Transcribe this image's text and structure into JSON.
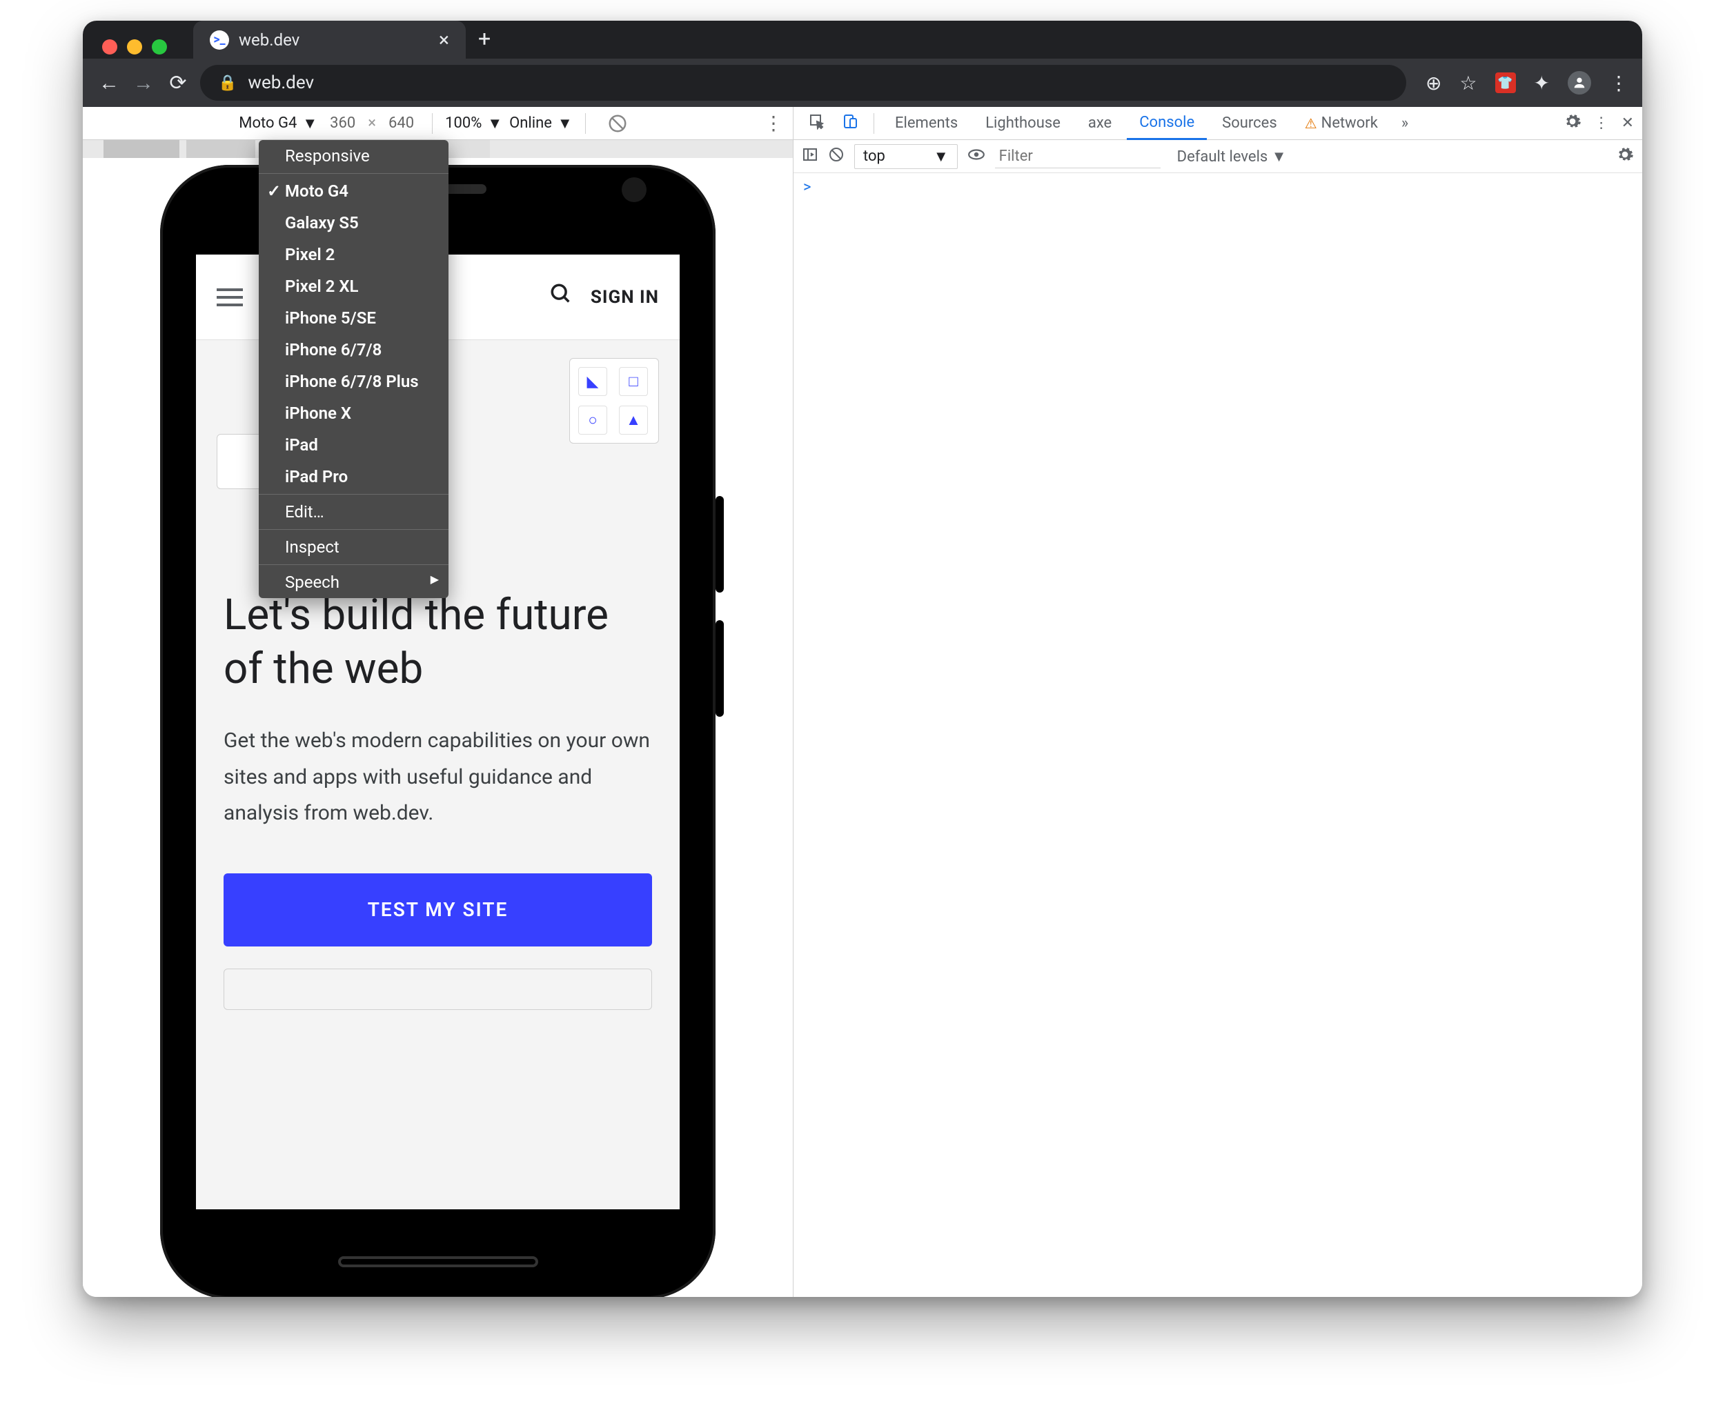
{
  "browser": {
    "tab_title": "web.dev",
    "url": "web.dev",
    "actions": {
      "add": "⊕",
      "star": "☆",
      "puzzle": "✦",
      "menu": "⋮"
    }
  },
  "deviceBar": {
    "device": "Moto G4",
    "width": "360",
    "height": "640",
    "zoom": "100%",
    "throttle": "Online"
  },
  "deviceMenu": {
    "responsive": "Responsive",
    "devices": [
      "Moto G4",
      "Galaxy S5",
      "Pixel 2",
      "Pixel 2 XL",
      "iPhone 5/SE",
      "iPhone 6/7/8",
      "iPhone 6/7/8 Plus",
      "iPhone X",
      "iPad",
      "iPad Pro"
    ],
    "selected": "Moto G4",
    "edit": "Edit…",
    "inspect": "Inspect",
    "speech": "Speech"
  },
  "page": {
    "signin": "SIGN IN",
    "heading": "Let's build the future of the web",
    "sub": "Get the web's modern capabilities on your own sites and apps with useful guidance and analysis from web.dev.",
    "cta": "TEST MY SITE"
  },
  "devtools": {
    "tabs": [
      "Elements",
      "Lighthouse",
      "axe",
      "Console",
      "Sources",
      "Network"
    ],
    "active": "Console",
    "more": "»"
  },
  "consoleBar": {
    "context": "top",
    "filter_ph": "Filter",
    "levels": "Default levels"
  },
  "console": {
    "prompt": ">"
  }
}
